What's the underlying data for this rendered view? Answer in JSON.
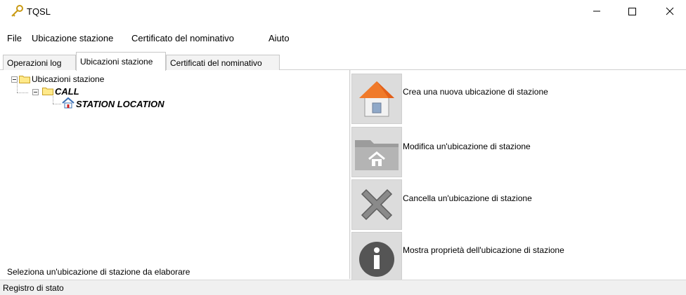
{
  "window": {
    "title": "TQSL",
    "icon": "key-icon",
    "controls": {
      "minimize": "minimize-icon",
      "maximize": "maximize-icon",
      "close": "close-icon"
    }
  },
  "menu": {
    "items": [
      {
        "label": "File"
      },
      {
        "label": "Ubicazione stazione"
      },
      {
        "label": "Certificato del nominativo"
      },
      {
        "label": "Aiuto"
      }
    ]
  },
  "tabs": [
    {
      "label": "Operazioni log",
      "active": false
    },
    {
      "label": "Ubicazioni stazione",
      "active": true
    },
    {
      "label": "Certificati del nominativo",
      "active": false
    }
  ],
  "tree": {
    "root": {
      "label": "Ubicazioni stazione",
      "icon": "folder-icon"
    },
    "callsign": {
      "label": "CALL",
      "icon": "folder-icon"
    },
    "location": {
      "label": "STATION LOCATION",
      "icon": "house-icon"
    }
  },
  "hint": "Seleziona un'ubicazione di stazione da elaborare",
  "actions": [
    {
      "label": "Crea una nuova ubicazione di stazione",
      "icon": "new-house-icon"
    },
    {
      "label": "Modifica un'ubicazione di stazione",
      "icon": "folder-house-icon"
    },
    {
      "label": "Cancella un'ubicazione di stazione",
      "icon": "delete-x-icon"
    },
    {
      "label": "Mostra proprietà dell'ubicazione di stazione",
      "icon": "info-icon"
    }
  ],
  "status": {
    "label": "Registro di stato"
  },
  "colors": {
    "folder": "#ffe98a",
    "house_roof": "#f07a2a",
    "accent_blue": "#3a6fb5"
  }
}
